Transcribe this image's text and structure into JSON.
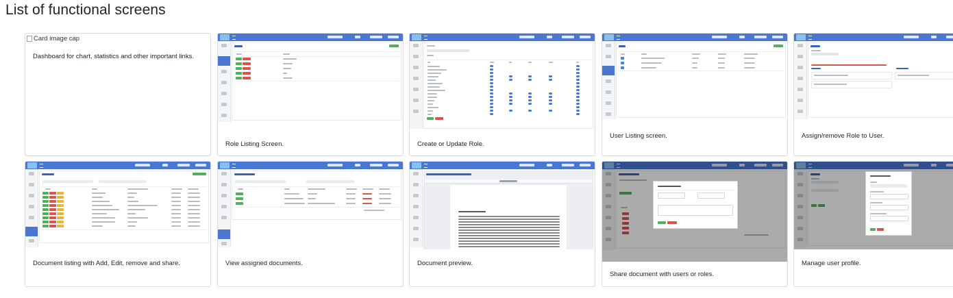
{
  "page": {
    "title": "List of functional screens"
  },
  "broken_image": {
    "alt": "Card image cap"
  },
  "cards": [
    {
      "caption": "Dashboard for chart, statistics and other important links."
    },
    {
      "caption": "Role Listing Screen."
    },
    {
      "caption": "Create or Update Role."
    },
    {
      "caption": "User Listing screen."
    },
    {
      "caption": "Assign/remove Role to User."
    },
    {
      "caption": "Document listing with Add, Edit, remove and share."
    },
    {
      "caption": "View assigned documents."
    },
    {
      "caption": "Document preview."
    },
    {
      "caption": "Share document with users or roles."
    },
    {
      "caption": "Manage user profile."
    }
  ],
  "colors": {
    "app_header": "#4a78d0",
    "success": "#52b05c",
    "danger": "#d9534f",
    "warning": "#e8b63a"
  },
  "icons": [
    "broken-image-icon",
    "app-logo-icon",
    "hamburger-icon"
  ]
}
